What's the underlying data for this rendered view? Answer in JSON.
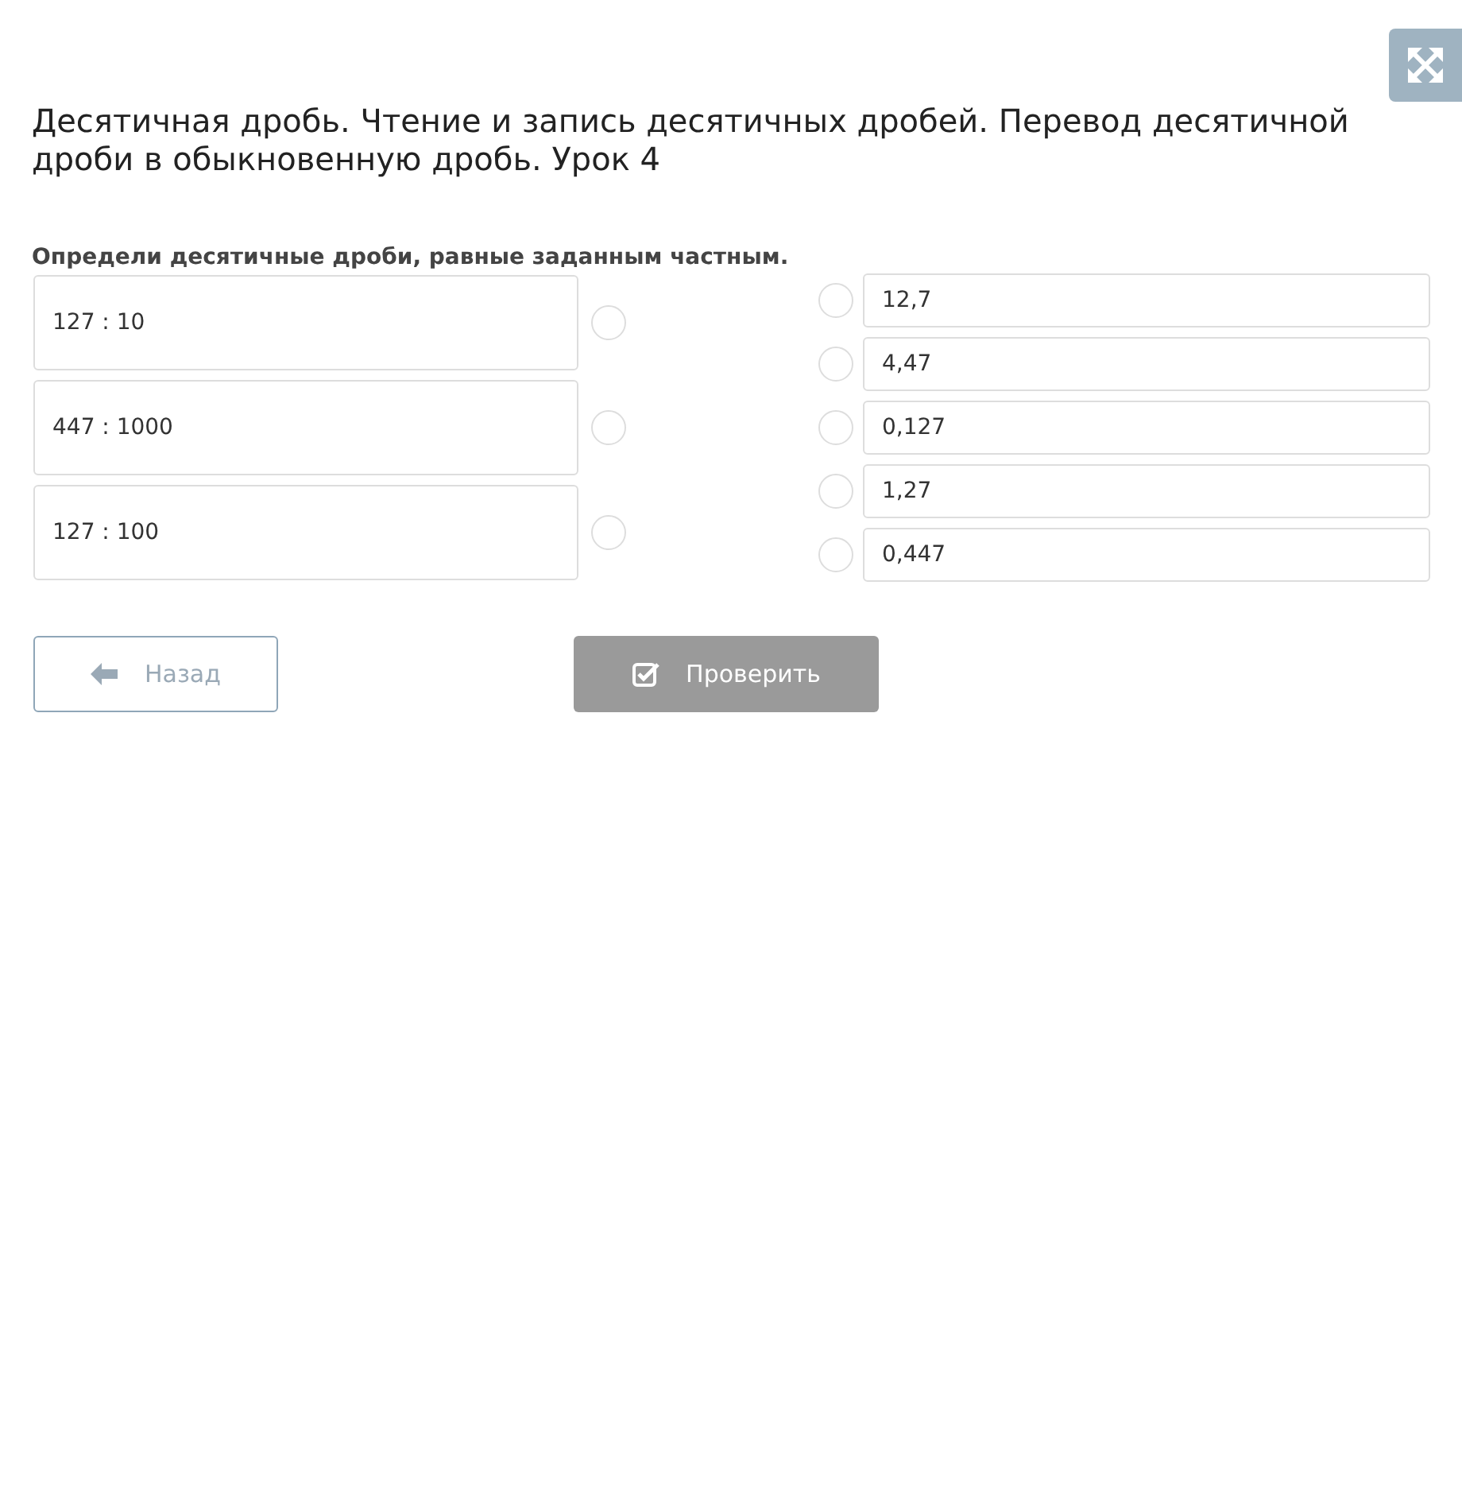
{
  "title": "Десятичная дробь. Чтение и запись десятичных дробей. Перевод десятичной дроби в обыкновенную дробь. Урок 4",
  "instruction": "Определи десятичные дроби, равные заданным частным.",
  "left_items": [
    {
      "text": "127 : 10",
      "selected": false
    },
    {
      "text": "447 : 1000",
      "selected": false
    },
    {
      "text": "127 : 100",
      "selected": false
    }
  ],
  "right_items": [
    {
      "text": "12,7",
      "selected": false
    },
    {
      "text": "4,47",
      "selected": false
    },
    {
      "text": "0,127",
      "selected": false
    },
    {
      "text": "1,27",
      "selected": false
    },
    {
      "text": "0,447",
      "selected": false
    }
  ],
  "back_button": {
    "label": "Назад",
    "disabled": false
  },
  "check_button": {
    "label": "Проверить",
    "disabled": true
  }
}
